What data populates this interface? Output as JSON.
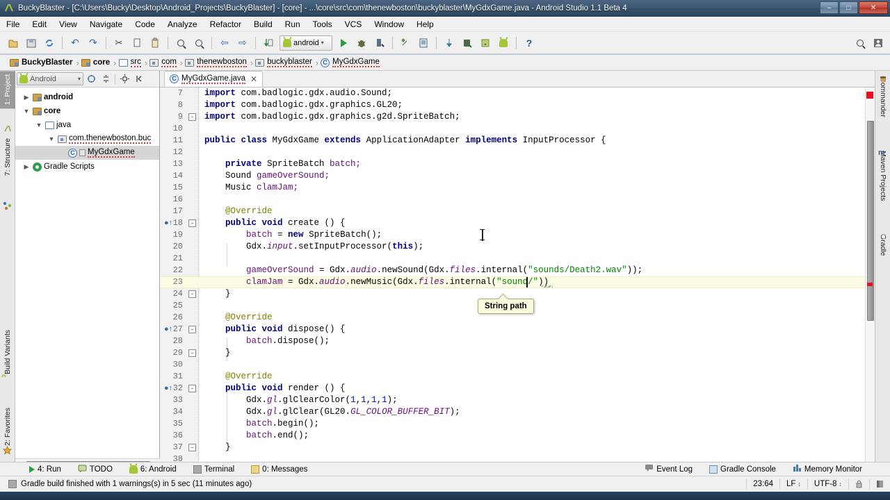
{
  "window": {
    "title": "BuckyBlaster - [C:\\Users\\Bucky\\Desktop\\Android_Projects\\BuckyBlaster] - [core] - ...\\core\\src\\com\\thenewboston\\buckyblaster\\MyGdxGame.java - Android Studio 1.1 Beta 4",
    "minimize": "–",
    "maximize": "□",
    "close": "✕"
  },
  "menubar": {
    "items": [
      {
        "label": "File"
      },
      {
        "label": "Edit"
      },
      {
        "label": "View"
      },
      {
        "label": "Navigate"
      },
      {
        "label": "Code"
      },
      {
        "label": "Analyze"
      },
      {
        "label": "Refactor"
      },
      {
        "label": "Build"
      },
      {
        "label": "Run"
      },
      {
        "label": "Tools"
      },
      {
        "label": "VCS"
      },
      {
        "label": "Window"
      },
      {
        "label": "Help"
      }
    ]
  },
  "toolbar": {
    "run_config": "android",
    "run_config_caret": "▾",
    "help_label": "?"
  },
  "breadcrumb": {
    "items": [
      {
        "label": "BuckyBlaster",
        "icon": "module-icon",
        "bold": true
      },
      {
        "label": "core",
        "icon": "module-icon",
        "bold": true
      },
      {
        "label": "src",
        "icon": "folder-icon",
        "bold": false
      },
      {
        "label": "com",
        "icon": "package-icon",
        "bold": false
      },
      {
        "label": "thenewboston",
        "icon": "package-icon",
        "bold": false
      },
      {
        "label": "buckyblaster",
        "icon": "package-icon",
        "bold": false
      },
      {
        "label": "MyGdxGame",
        "icon": "class-icon",
        "bold": false
      }
    ],
    "separator": "›"
  },
  "left_strip": {
    "tabs": [
      {
        "label": "1: Project",
        "active": true
      },
      {
        "label": "7: Structure",
        "active": false
      },
      {
        "label": "Build Variants",
        "active": false
      },
      {
        "label": "2: Favorites",
        "active": false
      }
    ]
  },
  "right_strip": {
    "tabs": [
      {
        "label": "Commander"
      },
      {
        "label": "Maven Projects"
      },
      {
        "label": "Gradle"
      }
    ]
  },
  "project_panel": {
    "view_selector": "Android",
    "view_selector_caret": "▾",
    "tree": [
      {
        "label": "android",
        "indent": 0,
        "twisty": "▶",
        "icon": "module-icon",
        "bold": true,
        "selected": false,
        "spell": false
      },
      {
        "label": "core",
        "indent": 0,
        "twisty": "▼",
        "icon": "module-icon",
        "bold": true,
        "selected": false,
        "spell": false
      },
      {
        "label": "java",
        "indent": 1,
        "twisty": "▼",
        "icon": "folder-icon",
        "bold": false,
        "selected": false,
        "spell": false
      },
      {
        "label": "com.thenewboston.buc",
        "indent": 2,
        "twisty": "▼",
        "icon": "package-icon",
        "bold": false,
        "selected": false,
        "spell": true
      },
      {
        "label": "MyGdxGame",
        "indent": 3,
        "twisty": "",
        "icon": "class-icon",
        "bold": false,
        "selected": true,
        "spell": true
      },
      {
        "label": "Gradle Scripts",
        "indent": 0,
        "twisty": "▶",
        "icon": "gradle-icon",
        "bold": false,
        "selected": false,
        "spell": false
      }
    ]
  },
  "editor": {
    "tab": {
      "label": "MyGdxGame.java",
      "close": "✕",
      "icon": "class-icon"
    },
    "first_line_number": 7,
    "lines": [
      {
        "n": 7,
        "fold": "",
        "override": false,
        "tokens": [
          {
            "t": "import ",
            "c": "kw"
          },
          {
            "t": "com.badlogic.gdx.audio.Sound;",
            "c": "pln"
          }
        ]
      },
      {
        "n": 8,
        "fold": "",
        "override": false,
        "tokens": [
          {
            "t": "import ",
            "c": "kw"
          },
          {
            "t": "com.badlogic.gdx.graphics.GL20;",
            "c": "pln"
          }
        ]
      },
      {
        "n": 9,
        "fold": "-",
        "override": false,
        "tokens": [
          {
            "t": "import ",
            "c": "kw"
          },
          {
            "t": "com.badlogic.gdx.graphics.g2d.SpriteBatch;",
            "c": "pln"
          }
        ]
      },
      {
        "n": 10,
        "fold": "",
        "override": false,
        "tokens": []
      },
      {
        "n": 11,
        "fold": "",
        "override": false,
        "tokens": [
          {
            "t": "public class ",
            "c": "kw"
          },
          {
            "t": "MyGdxGame ",
            "c": "pln"
          },
          {
            "t": "extends ",
            "c": "kw"
          },
          {
            "t": "ApplicationAdapter ",
            "c": "pln"
          },
          {
            "t": "implements ",
            "c": "kw"
          },
          {
            "t": "InputProcessor {",
            "c": "pln"
          }
        ]
      },
      {
        "n": 12,
        "fold": "",
        "override": false,
        "tokens": []
      },
      {
        "n": 13,
        "fold": "",
        "override": false,
        "tokens": [
          {
            "t": "    ",
            "c": "pln"
          },
          {
            "t": "private ",
            "c": "kw"
          },
          {
            "t": "SpriteBatch ",
            "c": "pln"
          },
          {
            "t": "batch;",
            "c": "fld"
          }
        ]
      },
      {
        "n": 14,
        "fold": "",
        "override": false,
        "tokens": [
          {
            "t": "    Sound ",
            "c": "pln"
          },
          {
            "t": "gameOverSound;",
            "c": "fld"
          }
        ]
      },
      {
        "n": 15,
        "fold": "",
        "override": false,
        "tokens": [
          {
            "t": "    Music ",
            "c": "pln"
          },
          {
            "t": "clamJam;",
            "c": "fld"
          }
        ]
      },
      {
        "n": 16,
        "fold": "",
        "override": false,
        "tokens": []
      },
      {
        "n": 17,
        "fold": "",
        "override": false,
        "tokens": [
          {
            "t": "    @Override",
            "c": "ann"
          }
        ]
      },
      {
        "n": 18,
        "fold": "-",
        "override": true,
        "tokens": [
          {
            "t": "    ",
            "c": "pln"
          },
          {
            "t": "public void ",
            "c": "kw"
          },
          {
            "t": "create () {",
            "c": "pln"
          }
        ]
      },
      {
        "n": 19,
        "fold": "",
        "override": false,
        "tokens": [
          {
            "t": "        ",
            "c": "pln"
          },
          {
            "t": "batch",
            "c": "fld"
          },
          {
            "t": " = ",
            "c": "pln"
          },
          {
            "t": "new ",
            "c": "kw"
          },
          {
            "t": "SpriteBatch();",
            "c": "pln"
          }
        ]
      },
      {
        "n": 20,
        "fold": "",
        "override": false,
        "tokens": [
          {
            "t": "        Gdx.",
            "c": "pln"
          },
          {
            "t": "input",
            "c": "stat"
          },
          {
            "t": ".setInputProcessor(",
            "c": "pln"
          },
          {
            "t": "this",
            "c": "kw"
          },
          {
            "t": ");",
            "c": "pln"
          }
        ]
      },
      {
        "n": 21,
        "fold": "",
        "override": false,
        "tokens": []
      },
      {
        "n": 22,
        "fold": "",
        "override": false,
        "tokens": [
          {
            "t": "        ",
            "c": "pln"
          },
          {
            "t": "gameOverSound",
            "c": "fld"
          },
          {
            "t": " = Gdx.",
            "c": "pln"
          },
          {
            "t": "audio",
            "c": "stat"
          },
          {
            "t": ".newSound(Gdx.",
            "c": "pln"
          },
          {
            "t": "files",
            "c": "stat"
          },
          {
            "t": ".internal(",
            "c": "pln"
          },
          {
            "t": "\"sounds/Death2.wav\"",
            "c": "str"
          },
          {
            "t": "));",
            "c": "pln"
          }
        ]
      },
      {
        "n": 23,
        "fold": "",
        "override": false,
        "current": true,
        "tokens": [
          {
            "t": "        ",
            "c": "pln"
          },
          {
            "t": "clamJam",
            "c": "fld"
          },
          {
            "t": " = Gdx.",
            "c": "pln"
          },
          {
            "t": "audio",
            "c": "stat"
          },
          {
            "t": ".newMusic(Gdx.",
            "c": "pln"
          },
          {
            "t": "files",
            "c": "stat"
          },
          {
            "t": ".internal(",
            "c": "pln"
          },
          {
            "t": "\"sound/\"",
            "c": "str"
          },
          {
            "t": "))",
            "c": "pln"
          }
        ]
      },
      {
        "n": 24,
        "fold": "-",
        "override": false,
        "tokens": [
          {
            "t": "    }",
            "c": "pln"
          }
        ]
      },
      {
        "n": 25,
        "fold": "",
        "override": false,
        "tokens": []
      },
      {
        "n": 26,
        "fold": "",
        "override": false,
        "tokens": [
          {
            "t": "    @Override",
            "c": "ann"
          }
        ]
      },
      {
        "n": 27,
        "fold": "-",
        "override": true,
        "tokens": [
          {
            "t": "    ",
            "c": "pln"
          },
          {
            "t": "public void ",
            "c": "kw"
          },
          {
            "t": "dispose() {",
            "c": "pln"
          }
        ]
      },
      {
        "n": 28,
        "fold": "",
        "override": false,
        "tokens": [
          {
            "t": "        ",
            "c": "pln"
          },
          {
            "t": "batch",
            "c": "fld"
          },
          {
            "t": ".dispose();",
            "c": "pln"
          }
        ]
      },
      {
        "n": 29,
        "fold": "-",
        "override": false,
        "tokens": [
          {
            "t": "    }",
            "c": "pln"
          }
        ]
      },
      {
        "n": 30,
        "fold": "",
        "override": false,
        "tokens": []
      },
      {
        "n": 31,
        "fold": "",
        "override": false,
        "tokens": [
          {
            "t": "    @Override",
            "c": "ann"
          }
        ]
      },
      {
        "n": 32,
        "fold": "-",
        "override": true,
        "tokens": [
          {
            "t": "    ",
            "c": "pln"
          },
          {
            "t": "public void ",
            "c": "kw"
          },
          {
            "t": "render () {",
            "c": "pln"
          }
        ]
      },
      {
        "n": 33,
        "fold": "",
        "override": false,
        "tokens": [
          {
            "t": "        Gdx.",
            "c": "pln"
          },
          {
            "t": "gl",
            "c": "stat"
          },
          {
            "t": ".glClearColor(",
            "c": "pln"
          },
          {
            "t": "1",
            "c": "num"
          },
          {
            "t": ",",
            "c": "pln"
          },
          {
            "t": "1",
            "c": "num"
          },
          {
            "t": ",",
            "c": "pln"
          },
          {
            "t": "1",
            "c": "num"
          },
          {
            "t": ",",
            "c": "pln"
          },
          {
            "t": "1",
            "c": "num"
          },
          {
            "t": ");",
            "c": "pln"
          }
        ]
      },
      {
        "n": 34,
        "fold": "",
        "override": false,
        "tokens": [
          {
            "t": "        Gdx.",
            "c": "pln"
          },
          {
            "t": "gl",
            "c": "stat"
          },
          {
            "t": ".glClear(GL20.",
            "c": "pln"
          },
          {
            "t": "GL_COLOR_BUFFER_BIT",
            "c": "itl"
          },
          {
            "t": ");",
            "c": "pln"
          }
        ]
      },
      {
        "n": 35,
        "fold": "",
        "override": false,
        "tokens": [
          {
            "t": "        ",
            "c": "pln"
          },
          {
            "t": "batch",
            "c": "fld"
          },
          {
            "t": ".begin();",
            "c": "pln"
          }
        ]
      },
      {
        "n": 36,
        "fold": "",
        "override": false,
        "tokens": [
          {
            "t": "        ",
            "c": "pln"
          },
          {
            "t": "batch",
            "c": "fld"
          },
          {
            "t": ".end();",
            "c": "pln"
          }
        ]
      },
      {
        "n": 37,
        "fold": "-",
        "override": false,
        "tokens": [
          {
            "t": "    }",
            "c": "pln"
          }
        ]
      },
      {
        "n": 38,
        "fold": "",
        "override": false,
        "tokens": []
      }
    ],
    "tooltip": {
      "text": "String path"
    }
  },
  "bottom_toolbar": {
    "left_items": [
      {
        "label": "4: Run",
        "icon": "run-icon"
      },
      {
        "label": "TODO",
        "icon": "todo-icon"
      },
      {
        "label": "6: Android",
        "icon": "android-icon"
      },
      {
        "label": "Terminal",
        "icon": "terminal-icon"
      },
      {
        "label": "0: Messages",
        "icon": "messages-icon"
      }
    ],
    "right_items": [
      {
        "label": "Event Log",
        "icon": "event-log-icon"
      },
      {
        "label": "Gradle Console",
        "icon": "gradle-console-icon"
      },
      {
        "label": "Memory Monitor",
        "icon": "memory-monitor-icon"
      }
    ]
  },
  "statusbar": {
    "message": "Gradle build finished with 1 warnings(s) in 5 sec (11 minutes ago)",
    "caret_position": "23:64",
    "line_separator": "LF",
    "encoding": "UTF-8",
    "stepper": "↕"
  }
}
